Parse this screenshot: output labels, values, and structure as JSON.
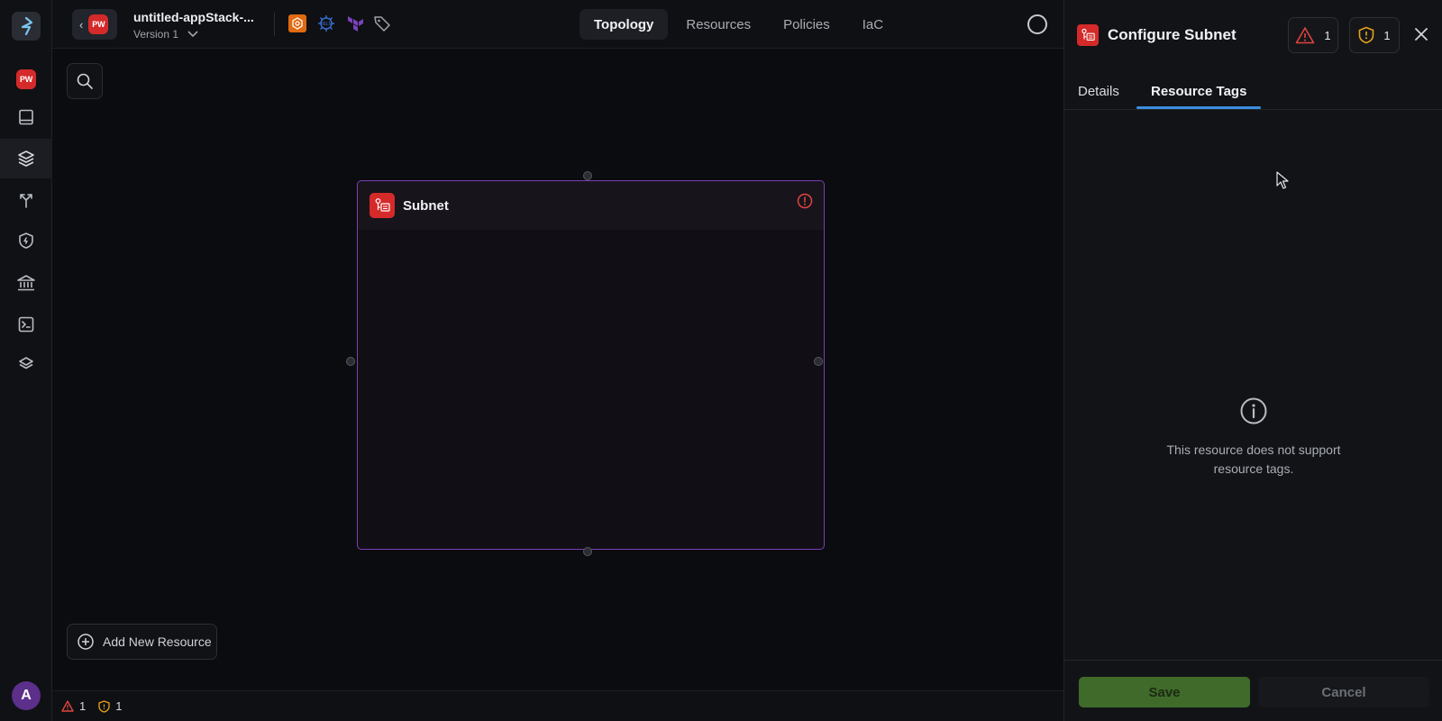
{
  "project": {
    "badge": "PW",
    "title": "untitled-appStack-...",
    "version": "Version 1"
  },
  "tabs": [
    {
      "label": "Topology",
      "active": true
    },
    {
      "label": "Resources",
      "active": false
    },
    {
      "label": "Policies",
      "active": false
    },
    {
      "label": "IaC",
      "active": false
    }
  ],
  "tech_icons": [
    "aws-icon",
    "helm-icon",
    "terraform-icon",
    "tag-icon"
  ],
  "sidebar": {
    "items": [
      {
        "name": "project-pw",
        "icon": "pw-badge"
      },
      {
        "name": "catalog",
        "icon": "book-icon"
      },
      {
        "name": "stacks",
        "icon": "layers-icon",
        "active": true
      },
      {
        "name": "branches",
        "icon": "git-branch-icon"
      },
      {
        "name": "policies",
        "icon": "shield-icon"
      },
      {
        "name": "bank",
        "icon": "bank-icon"
      },
      {
        "name": "terminal",
        "icon": "terminal-icon"
      },
      {
        "name": "resources",
        "icon": "stack-icon"
      }
    ],
    "avatar": "A"
  },
  "canvas": {
    "node_title": "Subnet",
    "add_resource_label": "Add New Resource"
  },
  "statusbar": {
    "errors": "1",
    "warnings": "1"
  },
  "panel": {
    "title": "Configure Subnet",
    "error_count": "1",
    "warning_count": "1",
    "tabs": [
      {
        "label": "Details",
        "active": false
      },
      {
        "label": "Resource Tags",
        "active": true
      }
    ],
    "empty_line1": "This resource does not support",
    "empty_line2": "resource tags.",
    "save_label": "Save",
    "cancel_label": "Cancel"
  },
  "colors": {
    "accent_blue": "#3b8ee0",
    "node_border": "#7b3fb5",
    "error_red": "#e0443e",
    "warning_amber": "#e6a21a",
    "save_green": "#3f6a2a"
  }
}
